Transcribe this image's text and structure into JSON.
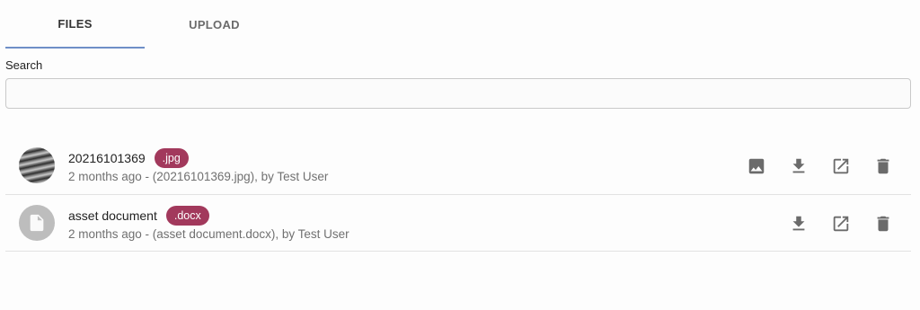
{
  "tabs": [
    {
      "label": "FILES",
      "active": true
    },
    {
      "label": "UPLOAD",
      "active": false
    }
  ],
  "search": {
    "label": "Search",
    "value": "",
    "placeholder": ""
  },
  "files": [
    {
      "name": "20216101369",
      "ext": ".jpg",
      "meta": "2 months ago - (20216101369.jpg), by Test User",
      "thumbnail": "photo",
      "actions": [
        "image-icon",
        "download-icon",
        "open-external-icon",
        "delete-icon"
      ]
    },
    {
      "name": "asset document",
      "ext": ".docx",
      "meta": "2 months ago - (asset document.docx), by Test User",
      "thumbnail": "file-icon",
      "actions": [
        "download-icon",
        "open-external-icon",
        "delete-icon"
      ]
    }
  ],
  "colors": {
    "badge": "#a2395c",
    "tab_indicator": "#6f8fc7",
    "icon": "#6b6b6b"
  }
}
